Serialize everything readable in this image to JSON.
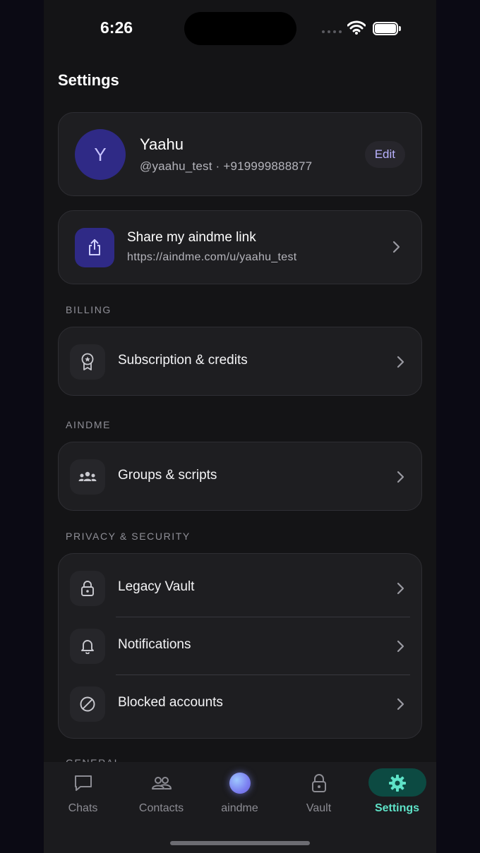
{
  "status_bar": {
    "time": "6:26"
  },
  "page_title": "Settings",
  "profile": {
    "avatar_initial": "Y",
    "name": "Yaahu",
    "handle_line": "@yaahu_test · +919999888877",
    "edit_label": "Edit"
  },
  "share": {
    "title": "Share my aindme link",
    "link": "https://aindme.com/u/yaahu_test"
  },
  "sections": {
    "billing": {
      "label": "BILLING",
      "items": [
        {
          "label": "Subscription & credits",
          "icon": "award-icon"
        }
      ]
    },
    "aindme": {
      "label": "AINDME",
      "items": [
        {
          "label": "Groups & scripts",
          "icon": "groups-icon"
        }
      ]
    },
    "privacy": {
      "label": "PRIVACY & SECURITY",
      "items": [
        {
          "label": "Legacy Vault",
          "icon": "lock-icon"
        },
        {
          "label": "Notifications",
          "icon": "bell-icon"
        },
        {
          "label": "Blocked accounts",
          "icon": "block-icon"
        }
      ]
    },
    "general": {
      "label": "GENERAL"
    }
  },
  "tabs": [
    {
      "label": "Chats",
      "icon": "chat-icon"
    },
    {
      "label": "Contacts",
      "icon": "contacts-icon"
    },
    {
      "label": "aindme",
      "icon": "orb-icon"
    },
    {
      "label": "Vault",
      "icon": "lock-icon"
    },
    {
      "label": "Settings",
      "icon": "gear-icon",
      "active": true
    }
  ],
  "colors": {
    "accent": "#5ee2c7",
    "avatar_bg": "#2f2a86",
    "edit_text": "#b9b2ff"
  }
}
